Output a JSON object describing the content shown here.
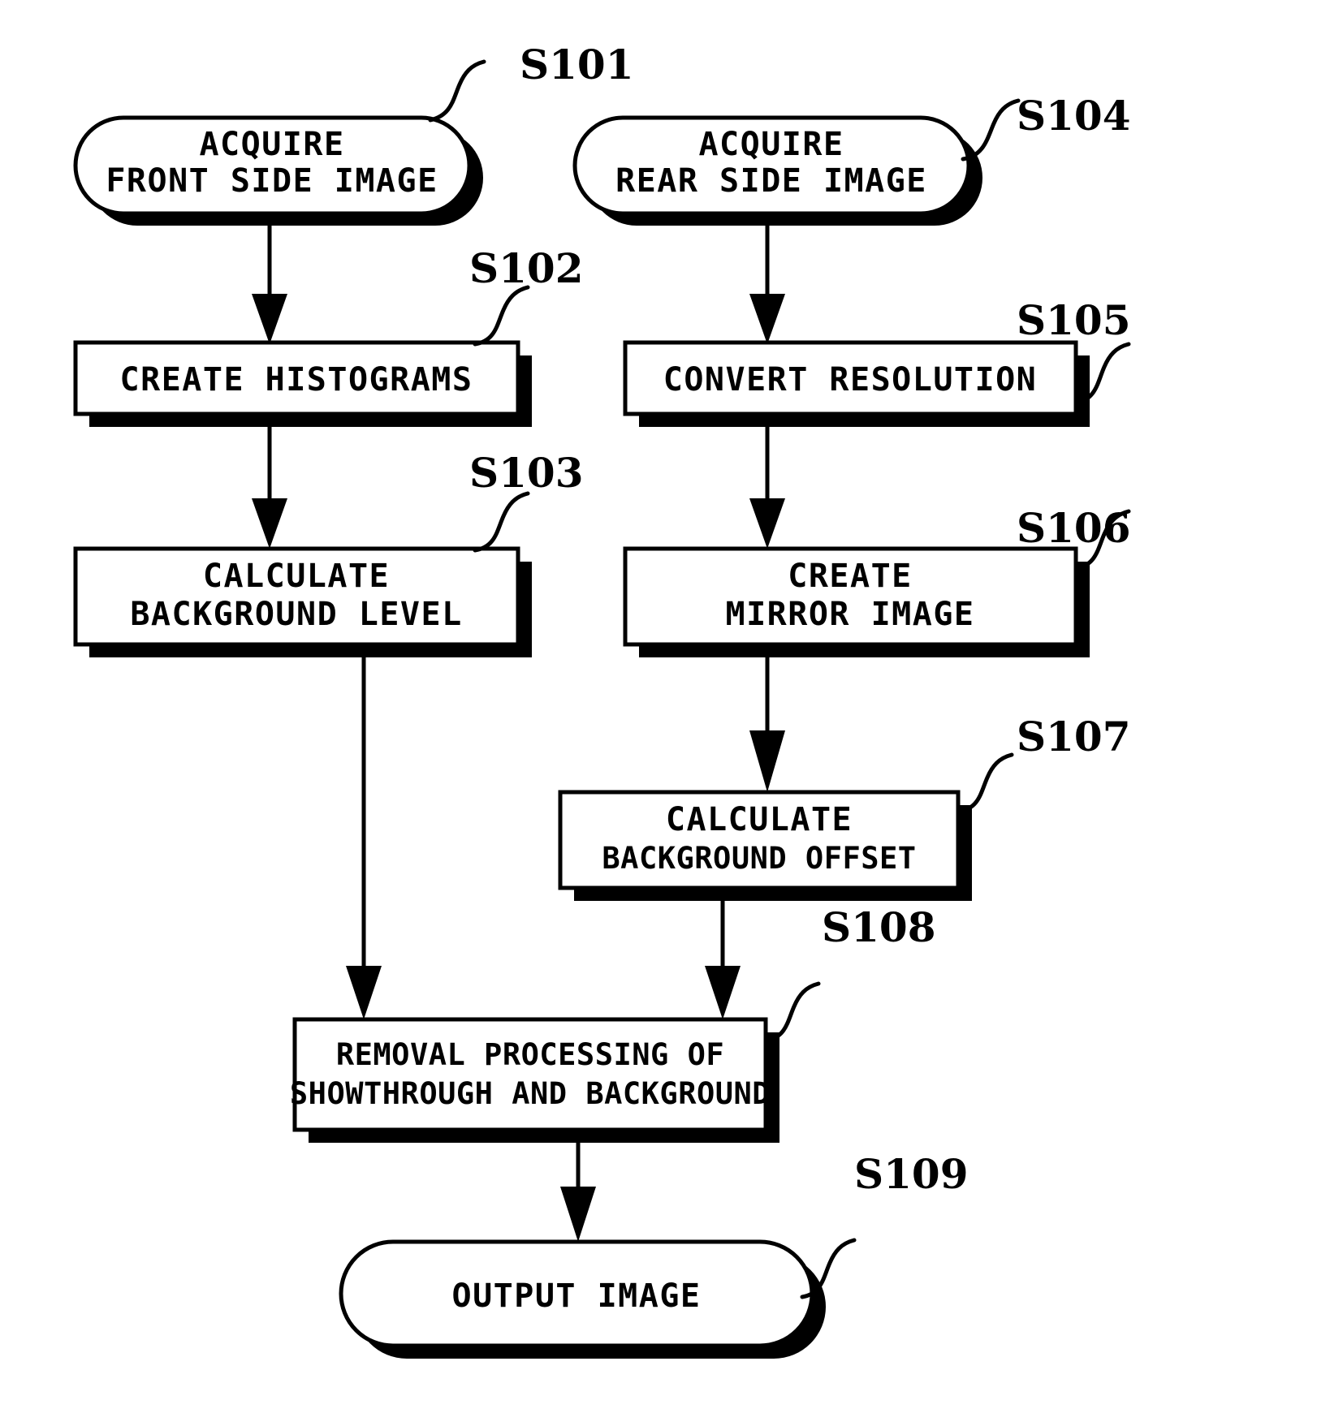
{
  "diagram": {
    "type": "flowchart",
    "title": "",
    "background_color": "#ffffff",
    "line_color": "#000000",
    "nodes": [
      {
        "id": "S101",
        "step_label": "S101",
        "shape": "stadium",
        "lines": [
          "ACQUIRE",
          "FRONT SIDE IMAGE"
        ],
        "line1": "ACQUIRE",
        "line2": "FRONT SIDE IMAGE"
      },
      {
        "id": "S102",
        "step_label": "S102",
        "shape": "rectangle",
        "lines": [
          "CREATE HISTOGRAMS"
        ],
        "line1": "CREATE HISTOGRAMS",
        "line2": ""
      },
      {
        "id": "S103",
        "step_label": "S103",
        "shape": "rectangle",
        "lines": [
          "CALCULATE",
          "BACKGROUND LEVEL"
        ],
        "line1": "CALCULATE",
        "line2": "BACKGROUND LEVEL"
      },
      {
        "id": "S104",
        "step_label": "S104",
        "shape": "stadium",
        "lines": [
          "ACQUIRE",
          "REAR SIDE IMAGE"
        ],
        "line1": "ACQUIRE",
        "line2": "REAR SIDE IMAGE"
      },
      {
        "id": "S105",
        "step_label": "S105",
        "shape": "rectangle",
        "lines": [
          "CONVERT RESOLUTION"
        ],
        "line1": "CONVERT RESOLUTION",
        "line2": ""
      },
      {
        "id": "S106",
        "step_label": "S106",
        "shape": "rectangle",
        "lines": [
          "CREATE",
          "MIRROR IMAGE"
        ],
        "line1": "CREATE",
        "line2": "MIRROR IMAGE"
      },
      {
        "id": "S107",
        "step_label": "S107",
        "shape": "rectangle",
        "lines": [
          "CALCULATE",
          "BACKGROUND OFFSET"
        ],
        "line1": "CALCULATE",
        "line2": "BACKGROUND OFFSET"
      },
      {
        "id": "S108",
        "step_label": "S108",
        "shape": "rectangle",
        "lines": [
          "REMOVAL PROCESSING OF",
          "SHOWTHROUGH AND BACKGROUND"
        ],
        "line1": "REMOVAL PROCESSING OF",
        "line2": "SHOWTHROUGH AND BACKGROUND"
      },
      {
        "id": "S109",
        "step_label": "S109",
        "shape": "stadium",
        "lines": [
          "OUTPUT IMAGE"
        ],
        "line1": "OUTPUT IMAGE",
        "line2": ""
      }
    ],
    "edges": [
      {
        "from": "S101",
        "to": "S102"
      },
      {
        "from": "S102",
        "to": "S103"
      },
      {
        "from": "S103",
        "to": "S108"
      },
      {
        "from": "S104",
        "to": "S105"
      },
      {
        "from": "S105",
        "to": "S106"
      },
      {
        "from": "S106",
        "to": "S107"
      },
      {
        "from": "S107",
        "to": "S108"
      },
      {
        "from": "S108",
        "to": "S109"
      }
    ]
  }
}
